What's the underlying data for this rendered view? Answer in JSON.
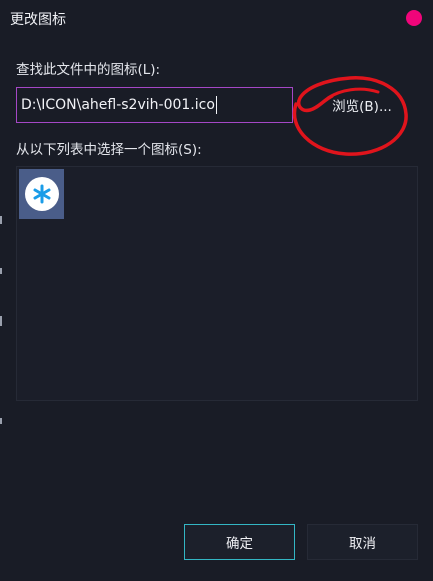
{
  "window": {
    "title": "更改图标"
  },
  "file_section": {
    "label": "查找此文件中的图标(L):",
    "path_value": "D:\\ICON\\ahefl-s2vih-001.ico",
    "browse_label": "浏览(B)..."
  },
  "icon_section": {
    "label": "从以下列表中选择一个图标(S):",
    "icons": [
      {
        "name": "asterisk-icon",
        "glyph": "*",
        "selected": false
      }
    ]
  },
  "buttons": {
    "ok_label": "确定",
    "cancel_label": "取消"
  },
  "colors": {
    "background": "#191c26",
    "close_dot": "#f0057a",
    "input_border": "#a547c6",
    "ok_border": "#33b6c4",
    "annotation_red": "#e0141c",
    "icon_tile": "#4a5d89",
    "icon_glyph": "#1a9ce8"
  }
}
